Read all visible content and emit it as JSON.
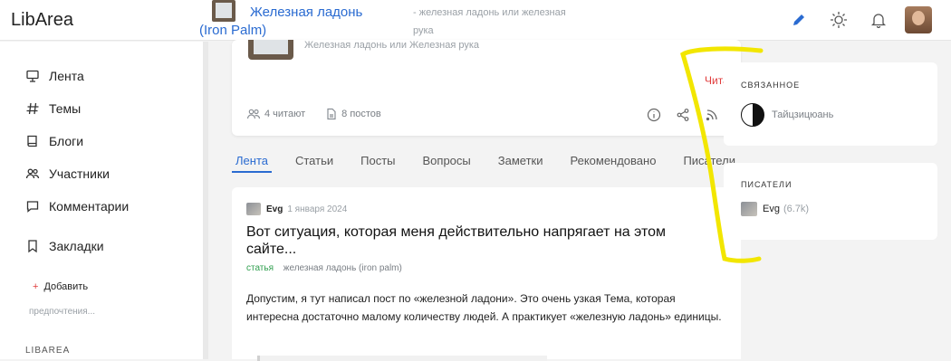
{
  "header": {
    "logo": "LibArea",
    "topic_title": "Железная ладонь (Iron Palm)",
    "topic_desc": "- железная ладонь или железная рука",
    "icons": [
      "pencil-icon",
      "sun-icon",
      "bell-icon",
      "avatar"
    ],
    "accent": "#2a6bd1"
  },
  "sidebar": {
    "items": [
      {
        "label": "Лента",
        "icon": "monitor-icon"
      },
      {
        "label": "Темы",
        "icon": "hash-icon"
      },
      {
        "label": "Блоги",
        "icon": "book-icon"
      },
      {
        "label": "Участники",
        "icon": "users-icon"
      },
      {
        "label": "Комментарии",
        "icon": "comment-icon"
      },
      {
        "label": "Закладки",
        "icon": "bookmark-icon"
      }
    ],
    "add_label": "Добавить",
    "prefs_label": "предпочтения...",
    "section_label": "LIBAREA"
  },
  "topic": {
    "subtitle": "Железная ладонь или Железная рука",
    "read_label": "Читать",
    "readers": "4 читают",
    "posts": "8 постов"
  },
  "tabs": [
    "Лента",
    "Статьи",
    "Посты",
    "Вопросы",
    "Заметки",
    "Рекомендовано",
    "Писатели"
  ],
  "post": {
    "author": "Evg",
    "date": "1 января 2024",
    "title": "Вот ситуация, которая меня действительно напрягает на этом сайте...",
    "type": "статья",
    "topic": "железная ладонь (iron palm)",
    "body": "Допустим, я тут написал пост по «железной ладони». Это очень узкая Тема, которая интересна достаточно малому количеству людей. А практикует «железную ладонь» единицы."
  },
  "related": {
    "heading": "СВЯЗАННОЕ",
    "items": [
      {
        "label": "Тайцзицюань",
        "icon": "yin-yang-icon"
      }
    ]
  },
  "writers": {
    "heading": "ПИСАТЕЛИ",
    "items": [
      {
        "name": "Evg",
        "karma": "(6.7k)"
      }
    ]
  },
  "annotation_color": "#f2e600"
}
